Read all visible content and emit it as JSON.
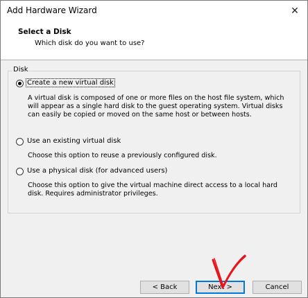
{
  "window": {
    "title": "Add Hardware Wizard",
    "close_glyph": "✕"
  },
  "header": {
    "title": "Select a Disk",
    "subtitle": "Which disk do you want to use?"
  },
  "disk_group": {
    "label": "Disk",
    "selected_option": "create_new",
    "options": [
      {
        "id": "create_new",
        "label": "Create a new virtual disk",
        "checked": true,
        "description": "A virtual disk is composed of one or more files on the host file system, which will appear as a single hard disk to the guest operating system. Virtual disks can easily be copied or moved on the same host or between hosts."
      },
      {
        "id": "use_existing",
        "label": "Use an existing virtual disk",
        "checked": false,
        "description": "Choose this option to reuse a previously configured disk."
      },
      {
        "id": "use_physical",
        "label": "Use a physical disk (for advanced users)",
        "checked": false,
        "description": "Choose this option to give the virtual machine direct access to a local hard disk. Requires administrator privileges."
      }
    ]
  },
  "buttons": {
    "back": "< Back",
    "next": "Next >",
    "cancel": "Cancel"
  },
  "annotation": {
    "type": "red-checkmark",
    "color": "#e8141b"
  }
}
